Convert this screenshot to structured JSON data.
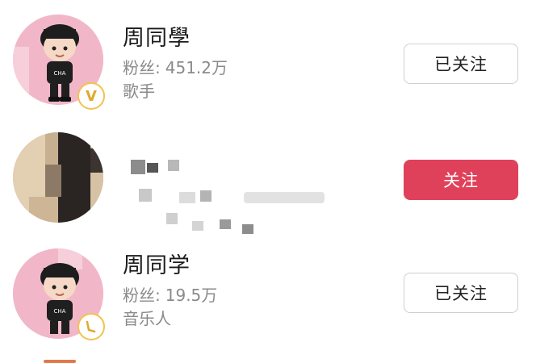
{
  "accent_color": "#e0415a",
  "badge_color": "#f2c24f",
  "users": [
    {
      "name": "周同學",
      "fans_label": "粉丝:",
      "fans_value": "451.2万",
      "occupation": "歌手",
      "button_label": "已关注",
      "verified_badge_text": "V",
      "avatar_icon": "cartoon-boy-avatar"
    },
    {
      "button_label": "关注",
      "avatar_icon": "pixelated-avatar"
    },
    {
      "name": "周同学",
      "fans_label": "粉丝:",
      "fans_value": "19.5万",
      "occupation": "音乐人",
      "button_label": "已关注",
      "avatar_icon": "cartoon-boy-avatar"
    }
  ]
}
